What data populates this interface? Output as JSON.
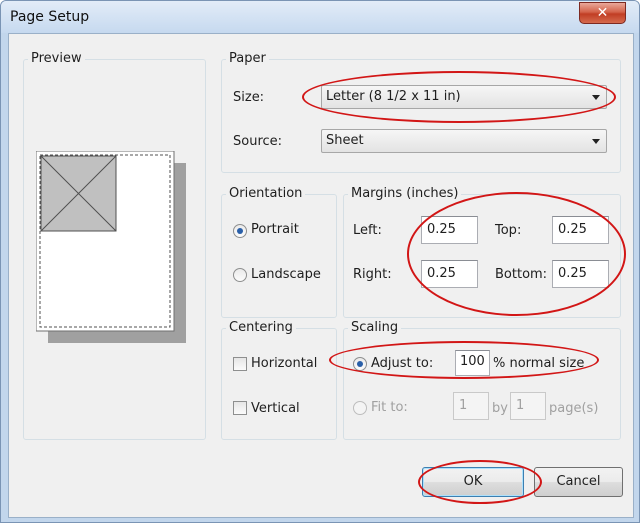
{
  "window": {
    "title": "Page Setup",
    "close_glyph": "✕"
  },
  "preview": {
    "label": "Preview"
  },
  "paper": {
    "label": "Paper",
    "size_label": "Size:",
    "size_value": "Letter (8 1/2 x 11 in)",
    "source_label": "Source:",
    "source_value": "Sheet"
  },
  "orientation": {
    "label": "Orientation",
    "portrait": "Portrait",
    "landscape": "Landscape",
    "selected": "Portrait"
  },
  "margins": {
    "label": "Margins (inches)",
    "left_label": "Left:",
    "left_value": "0.25",
    "top_label": "Top:",
    "top_value": "0.25",
    "right_label": "Right:",
    "right_value": "0.25",
    "bottom_label": "Bottom:",
    "bottom_value": "0.25"
  },
  "centering": {
    "label": "Centering",
    "horizontal": "Horizontal",
    "vertical": "Vertical"
  },
  "scaling": {
    "label": "Scaling",
    "adjust_label": "Adjust to:",
    "adjust_value": "100",
    "adjust_suffix": "% normal size",
    "fit_label": "Fit to:",
    "fit_wide": "1",
    "fit_by": "by",
    "fit_tall": "1",
    "fit_suffix": "page(s)"
  },
  "buttons": {
    "ok": "OK",
    "cancel": "Cancel"
  },
  "colors": {
    "annotation_red": "#d21616",
    "radio_dot": "#2a5fa8"
  }
}
